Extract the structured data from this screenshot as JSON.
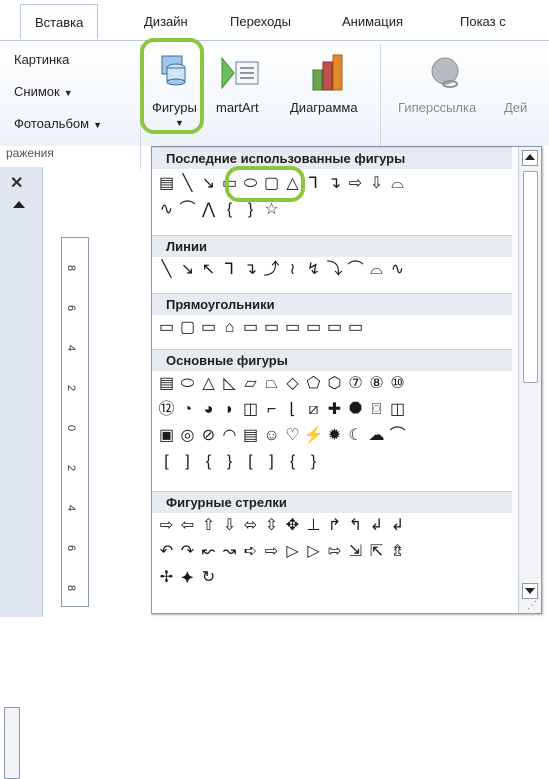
{
  "tabs": [
    "Вставка",
    "Дизайн",
    "Переходы",
    "Анимация",
    "Показ с"
  ],
  "ribbon": {
    "picture": "Картинка",
    "screenshot": "Снимок",
    "album": "Фотоальбом",
    "group_label": "ражения",
    "shapes": "Фигуры",
    "smartart": "martArt",
    "chart": "Диаграмма",
    "hyperlink": "Гиперссылка",
    "action": "Дей"
  },
  "dropdown": {
    "categories": {
      "recent": "Последние использованные фигуры",
      "lines": "Линии",
      "rectangles": "Прямоугольники",
      "basic": "Основные фигуры",
      "arrows": "Фигурные стрелки"
    },
    "rows": {
      "recent1": [
        "▤",
        "╲",
        "↘",
        "▭",
        "⬭",
        "▢",
        "△",
        "⅂",
        "↴",
        "⇨",
        "⇩",
        "⌓"
      ],
      "recent2": [
        "∿",
        "⌒",
        "⋀",
        "{",
        "}",
        "☆"
      ],
      "lines1": [
        "╲",
        "↘",
        "↖",
        "⅂",
        "↴",
        "⤴",
        "≀",
        "↯",
        "⤵",
        "⌒",
        "⌓",
        "∿"
      ],
      "rects1": [
        "▭",
        "▢",
        "▭",
        "⌂",
        "▭",
        "▭",
        "▭",
        "▭",
        "▭",
        "▭"
      ],
      "basic1": [
        "▤",
        "⬭",
        "△",
        "◺",
        "▱",
        "⏢",
        "◇",
        "⬠",
        "⬡",
        "⑦",
        "⑧",
        "⑩"
      ],
      "basic2": [
        "⑫",
        "◔",
        "◕",
        "◗",
        "◫",
        "⌐",
        "⌊",
        "⧄",
        "✚",
        "⯃",
        "⌼",
        "◫"
      ],
      "basic3": [
        "▣",
        "◎",
        "⊘",
        "◠",
        "▤",
        "☺",
        "♡",
        "⚡",
        "✹",
        "☾",
        "☁",
        "⌒"
      ],
      "basic4": [
        "[",
        "]",
        "{",
        "}",
        "[",
        "]",
        "{",
        "}"
      ],
      "arrows1": [
        "⇨",
        "⇦",
        "⇧",
        "⇩",
        "⬄",
        "⇳",
        "✥",
        "⊥",
        "↱",
        "↰",
        "↲",
        "↲"
      ],
      "arrows2": [
        "↶",
        "↷",
        "↜",
        "↝",
        "➪",
        "⇨",
        "▷",
        "▷",
        "⇰",
        "⇲",
        "⇱",
        "⇯"
      ],
      "arrows3": [
        "✢",
        "⯌",
        "↻"
      ]
    }
  },
  "ruler_marks": [
    "8",
    "6",
    "4",
    "2",
    "0",
    "2",
    "4",
    "6",
    "8"
  ],
  "colors": {
    "highlight": "#8cc63f",
    "ribbon_border": "#b9c9da"
  }
}
